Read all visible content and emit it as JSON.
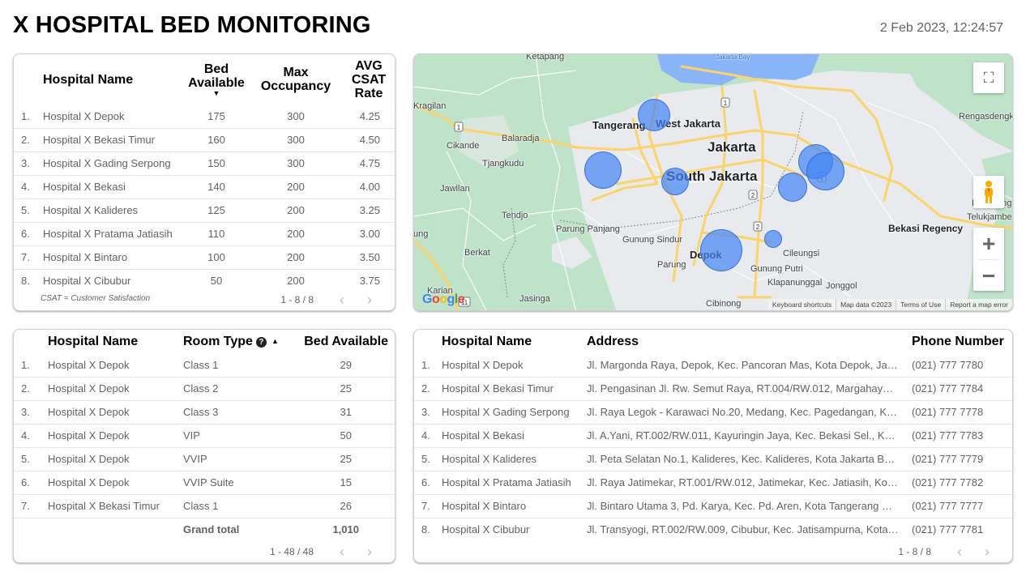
{
  "header": {
    "title": "X HOSPITAL BED MONITORING",
    "timestamp": "2 Feb 2023, 12:24:57"
  },
  "table_summary": {
    "columns": [
      "Hospital Name",
      "Bed Available",
      "Max Occupancy",
      "AVG CSAT Rate"
    ],
    "column_lines": {
      "bed": [
        "Bed",
        "Available"
      ],
      "occ": [
        "Max",
        "Occupancy"
      ],
      "csat": [
        "AVG",
        "CSAT",
        "Rate"
      ]
    },
    "sort_indicator": "▼",
    "rows": [
      {
        "idx": "1.",
        "name": "Hospital X Depok",
        "bed": "175",
        "occ": "300",
        "csat": "4.25"
      },
      {
        "idx": "2.",
        "name": "Hospital X Bekasi Timur",
        "bed": "160",
        "occ": "300",
        "csat": "4.50"
      },
      {
        "idx": "3.",
        "name": "Hospital X Gading Serpong",
        "bed": "150",
        "occ": "300",
        "csat": "4.75"
      },
      {
        "idx": "4.",
        "name": "Hospital X Bekasi",
        "bed": "140",
        "occ": "200",
        "csat": "4.00"
      },
      {
        "idx": "5.",
        "name": "Hospital X Kalideres",
        "bed": "125",
        "occ": "200",
        "csat": "3.25"
      },
      {
        "idx": "6.",
        "name": "Hospital X Pratama Jatiasih",
        "bed": "110",
        "occ": "200",
        "csat": "3.00"
      },
      {
        "idx": "7.",
        "name": "Hospital X Bintaro",
        "bed": "100",
        "occ": "200",
        "csat": "3.50"
      },
      {
        "idx": "8.",
        "name": "Hospital X Cibubur",
        "bed": "50",
        "occ": "200",
        "csat": "3.75"
      }
    ],
    "footnote": "CSAT = Customer Satisfaction",
    "pager": "1 - 8 / 8"
  },
  "table_rooms": {
    "columns": [
      "Hospital Name",
      "Room Type",
      "Bed Available"
    ],
    "help_icon": "?",
    "sort_indicator": "▲",
    "rows": [
      {
        "idx": "1.",
        "name": "Hospital X Depok",
        "room": "Class 1",
        "bed": "29"
      },
      {
        "idx": "2.",
        "name": "Hospital X Depok",
        "room": "Class 2",
        "bed": "25"
      },
      {
        "idx": "3.",
        "name": "Hospital X Depok",
        "room": "Class 3",
        "bed": "31"
      },
      {
        "idx": "4.",
        "name": "Hospital X Depok",
        "room": "VIP",
        "bed": "50"
      },
      {
        "idx": "5.",
        "name": "Hospital X Depok",
        "room": "VVIP",
        "bed": "25"
      },
      {
        "idx": "6.",
        "name": "Hospital X Depok",
        "room": "VVIP Suite",
        "bed": "15"
      },
      {
        "idx": "7.",
        "name": "Hospital X Bekasi Timur",
        "room": "Class 1",
        "bed": "26"
      }
    ],
    "grand_total_label": "Grand total",
    "grand_total_value": "1,010",
    "pager": "1 - 48 / 48"
  },
  "table_contacts": {
    "columns": [
      "Hospital Name",
      "Address",
      "Phone Number"
    ],
    "rows": [
      {
        "idx": "1.",
        "name": "Hospital X Depok",
        "address": "Jl. Margonda Raya, Depok, Kec. Pancoran Mas, Kota Depok, Jaw…",
        "phone": "(021) 777 7780"
      },
      {
        "idx": "2.",
        "name": "Hospital X Bekasi Timur",
        "address": "Jl. Pengasinan Jl. Rw. Semut Raya, RT.004/RW.012, Margahayu, …",
        "phone": "(021) 777 7784"
      },
      {
        "idx": "3.",
        "name": "Hospital X Gading Serpong",
        "address": "Jl. Raya Legok - Karawaci No.20, Medang, Kec. Pagedangan, Kab…",
        "phone": "(021) 777 7778"
      },
      {
        "idx": "4.",
        "name": "Hospital X Bekasi",
        "address": "Jl. A.Yani, RT.002/RW.011, Kayuringin Jaya, Kec. Bekasi Sel., Kot…",
        "phone": "(021) 777 7783"
      },
      {
        "idx": "5.",
        "name": "Hospital X Kalideres",
        "address": "Jl. Peta Selatan No.1, Kalideres, Kec. Kalideres, Kota Jakarta Bar…",
        "phone": "(021) 777 7779"
      },
      {
        "idx": "6.",
        "name": "Hospital X Pratama Jatiasih",
        "address": "Jl. Raya Jatimekar, RT.001/RW.012, Jatimekar, Kec. Jatiasih, Kot…",
        "phone": "(021) 777 7782"
      },
      {
        "idx": "7.",
        "name": "Hospital X Bintaro",
        "address": "Jl. Bintaro Utama 3, Pd. Karya, Kec. Pd. Aren, Kota Tangerang Sel…",
        "phone": "(021) 777 7777"
      },
      {
        "idx": "8.",
        "name": "Hospital X Cibubur",
        "address": "Jl. Transyogi, RT.002/RW.009, Cibubur, Kec. Jatisampurna, Kota …",
        "phone": "(021) 777 7781"
      }
    ],
    "pager": "1 - 8 / 8"
  },
  "map": {
    "labels": {
      "ketapang": "Ketapang",
      "jakarta_bay": "Jakarta Bay",
      "kragilan": "Kragilan",
      "tangerang": "Tangerang",
      "west_jakarta": "West Jakarta",
      "jakarta": "Jakarta",
      "south_jakarta": "South Jakarta",
      "rengasdengklok": "Rengasdengklok",
      "cikande": "Cikande",
      "balaradja": "Balaradja",
      "tjangkudu": "Tjangkudu",
      "jawilan": "Jawilan",
      "tendjo": "Tendjo",
      "parung_panjang": "Parung Panjang",
      "gunung_sindur": "Gunung Sindur",
      "parung": "Parung",
      "depok": "Depok",
      "cileungsi": "Cileungsi",
      "gunung_putri": "Gunung Putri",
      "klapanunggal": "Klapanunggal",
      "jonggol": "Jonggol",
      "bekasi_regency": "Bekasi Regency",
      "karawang": "Karawang",
      "telukjambe": "Telukjambe",
      "berkat": "Berkat",
      "jasinga": "Jasinga",
      "karian": "Karian",
      "cibinong": "Cibinong",
      "tung": "tung"
    },
    "highway_shields": [
      "1",
      "1",
      "1",
      "2",
      "2",
      "11"
    ],
    "bubbles": [
      {
        "hospital": "Hospital X Kalideres",
        "bed_available": 125
      },
      {
        "hospital": "Hospital X Gading Serpong",
        "bed_available": 150
      },
      {
        "hospital": "Hospital X Bintaro",
        "bed_available": 100
      },
      {
        "hospital": "Hospital X Bekasi Timur",
        "bed_available": 160
      },
      {
        "hospital": "Hospital X Bekasi",
        "bed_available": 140
      },
      {
        "hospital": "Hospital X Pratama Jatiasih",
        "bed_available": 110
      },
      {
        "hospital": "Hospital X Depok",
        "bed_available": 175
      },
      {
        "hospital": "Hospital X Cibubur",
        "bed_available": 50
      }
    ],
    "controls": {
      "fullscreen_icon": "⛶",
      "zoom_in": "+",
      "zoom_out": "−"
    },
    "attribution": [
      "Keyboard shortcuts",
      "Map data ©2023",
      "Terms of Use",
      "Report a map error"
    ],
    "google_logo": [
      "G",
      "o",
      "o",
      "g",
      "l",
      "e"
    ],
    "colors": {
      "water": "#8ab4f8",
      "park": "#bfe3c8",
      "urban": "#e8eaed",
      "road_major": "#fcd36b",
      "bubble": "#4285f4"
    }
  },
  "pager_icons": {
    "prev": "‹",
    "next": "›"
  }
}
